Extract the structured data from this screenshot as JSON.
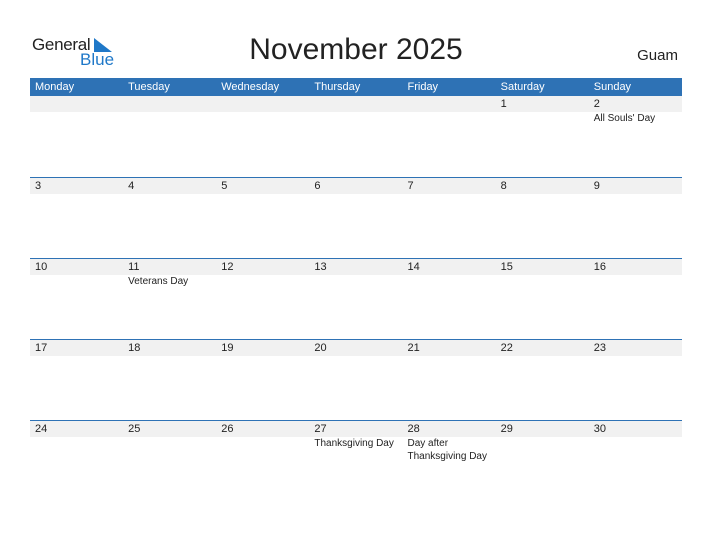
{
  "logo": {
    "general": "General",
    "blue": "Blue"
  },
  "title": "November 2025",
  "country": "Guam",
  "colors": {
    "accent": "#2e72b5",
    "strip": "#f1f1f1"
  },
  "weekdays": [
    "Monday",
    "Tuesday",
    "Wednesday",
    "Thursday",
    "Friday",
    "Saturday",
    "Sunday"
  ],
  "weeks": [
    [
      {
        "day": "",
        "holiday": ""
      },
      {
        "day": "",
        "holiday": ""
      },
      {
        "day": "",
        "holiday": ""
      },
      {
        "day": "",
        "holiday": ""
      },
      {
        "day": "",
        "holiday": ""
      },
      {
        "day": "1",
        "holiday": ""
      },
      {
        "day": "2",
        "holiday": "All Souls' Day"
      }
    ],
    [
      {
        "day": "3",
        "holiday": ""
      },
      {
        "day": "4",
        "holiday": ""
      },
      {
        "day": "5",
        "holiday": ""
      },
      {
        "day": "6",
        "holiday": ""
      },
      {
        "day": "7",
        "holiday": ""
      },
      {
        "day": "8",
        "holiday": ""
      },
      {
        "day": "9",
        "holiday": ""
      }
    ],
    [
      {
        "day": "10",
        "holiday": ""
      },
      {
        "day": "11",
        "holiday": "Veterans Day"
      },
      {
        "day": "12",
        "holiday": ""
      },
      {
        "day": "13",
        "holiday": ""
      },
      {
        "day": "14",
        "holiday": ""
      },
      {
        "day": "15",
        "holiday": ""
      },
      {
        "day": "16",
        "holiday": ""
      }
    ],
    [
      {
        "day": "17",
        "holiday": ""
      },
      {
        "day": "18",
        "holiday": ""
      },
      {
        "day": "19",
        "holiday": ""
      },
      {
        "day": "20",
        "holiday": ""
      },
      {
        "day": "21",
        "holiday": ""
      },
      {
        "day": "22",
        "holiday": ""
      },
      {
        "day": "23",
        "holiday": ""
      }
    ],
    [
      {
        "day": "24",
        "holiday": ""
      },
      {
        "day": "25",
        "holiday": ""
      },
      {
        "day": "26",
        "holiday": ""
      },
      {
        "day": "27",
        "holiday": "Thanksgiving Day"
      },
      {
        "day": "28",
        "holiday": "Day after Thanksgiving Day"
      },
      {
        "day": "29",
        "holiday": ""
      },
      {
        "day": "30",
        "holiday": ""
      }
    ]
  ]
}
